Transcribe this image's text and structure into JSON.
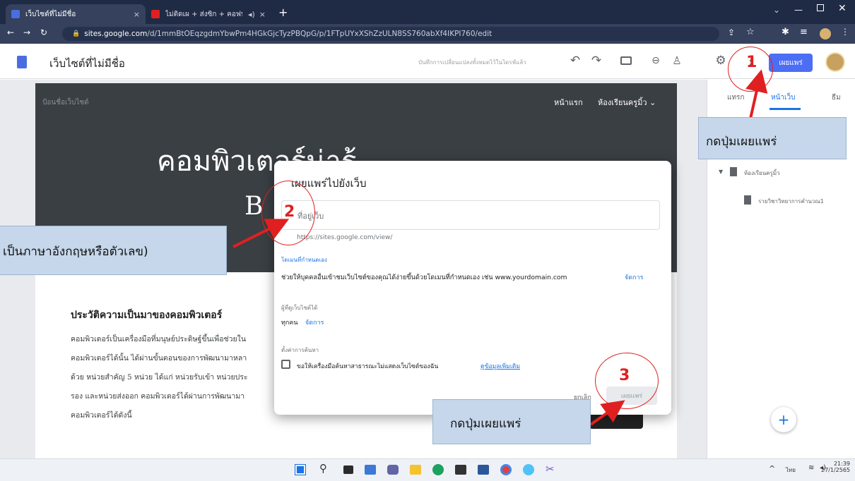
{
  "browser": {
    "tabs": [
      {
        "title": "เว็บไซต์ที่ไม่มีชื่อ",
        "close": "×"
      },
      {
        "title": "ไม่ติดเผ + ส่งซิก + คอฟบ + ให้ปี",
        "close": "×"
      }
    ],
    "new_tab": "+",
    "url_host": "sites.google.com",
    "url_path": "/d/1mmBtOEqzgdmYbwPm4HGkGjcTyzPBQpG/p/1FTpUYxXShZzULN8SS760abXf4IKPI760/edit"
  },
  "app": {
    "title": "เว็บไซต์ที่ไม่มีชื่อ",
    "save_status": "บันทึกการเปลี่ยนแปลงทั้งหมดไว้ในไดรฟ์แล้ว",
    "publish_label": "เผยแพร่"
  },
  "site": {
    "name_placeholder": "ป้อนชื่อเว็บไซต์",
    "nav_home": "หน้าแรก",
    "nav_class": "ห้องเรียนครูมิ้ว",
    "hero_title": "คอมพิวเตอร์น่ารู้",
    "hero_sub": "B",
    "section_title": "ประวัติความเป็นมาของคอมพิวเตอร์",
    "lines": [
      "คอมพิวเตอร์เป็นเครื่องมือที่มนุษย์ประดิษฐ์ขึ้นเพื่อช่วยใน",
      "คอมพิวเตอร์ได้นั้น ได้ผ่านขั้นตอนของการพัฒนามาหลา",
      "ด้วย หน่วยสำคัญ 5 หน่วย ได้แก่ หน่วยรับเข้า หน่วยประ",
      "รอง และหน่วยส่งออก คอมพิวเตอร์ได้ผ่านการพัฒนามา",
      "คอมพิวเตอร์ได้ดังนี้"
    ]
  },
  "side": {
    "tabs": [
      "แทรก",
      "หน้าเว็บ",
      "ธีม"
    ],
    "tree_parent": "ห้องเรียนครูมิ้ว",
    "tree_child": "รายวิชาวิทยาการคำนวณ1",
    "add_label": "+"
  },
  "dialog": {
    "title": "เผยแพร่ไปยังเว็บ",
    "address_placeholder": "ที่อยู่เว็บ",
    "url_prefix": "https://sites.google.com/view/",
    "custom_domain_heading": "โดเมนที่กำหนดเอง",
    "custom_domain_text": "ช่วยให้บุคคลอื่นเข้าชมเว็บไซต์ของคุณได้ง่ายขึ้นด้วยโดเมนที่กำหนดเอง เช่น www.yourdomain.com",
    "custom_domain_link": "จัดการ",
    "viewers_heading": "ผู้ที่ดูเว็บไซต์ได้",
    "viewers_value": "ทุกคน",
    "viewers_link": "จัดการ",
    "search_heading": "ตั้งค่าการค้นหา",
    "search_checkbox": "ขอให้เครื่องมือค้นหาสาธารณะไม่แสดงเว็บไซต์ของฉัน",
    "search_link": "ดูข้อมูลเพิ่มเติม",
    "cancel_label": "ยกเลิก",
    "publish_label": "เผยแพร่"
  },
  "annotations": {
    "step1": "1",
    "step2": "2",
    "step3": "3",
    "callout_top": "กดปุ่มเผยแพร่",
    "callout_left": "เป็นภาษาอังกฤษหรือตัวเลข)",
    "callout_bottom": "กดปุ่มเผยแพร่"
  },
  "taskbar": {
    "lang": "ไทย",
    "time": "21:39",
    "date": "27/1/2565"
  },
  "colors": {
    "publish_blue": "#4c6ef5",
    "annotation_red": "#e02020",
    "callout_fill": "#c6d7eb"
  }
}
